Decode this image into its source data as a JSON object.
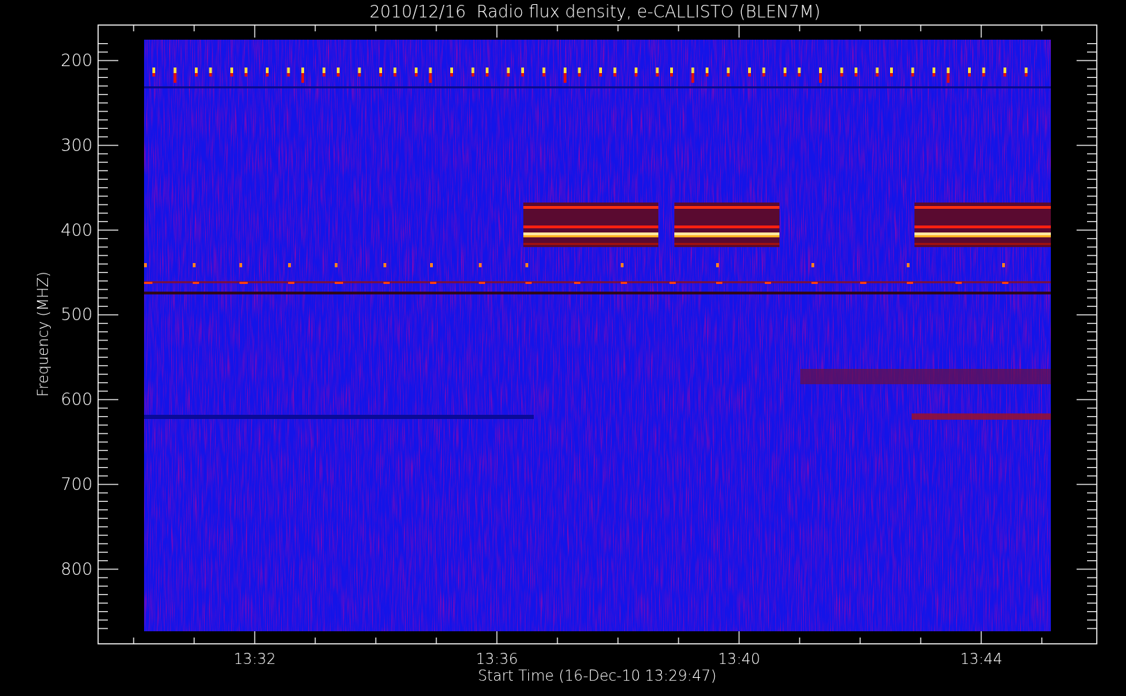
{
  "plot": {
    "title": "2010/12/16  Radio flux density, e-CALLISTO (BLEN7M)",
    "ylabel": "Frequency (MHZ)",
    "xlabel": "Start Time (16-Dec-10 13:29:47)",
    "yticks": [
      "200",
      "300",
      "400",
      "500",
      "600",
      "700",
      "800"
    ],
    "xticks": [
      "13:32",
      "13:36",
      "13:40",
      "13:44"
    ]
  }
}
